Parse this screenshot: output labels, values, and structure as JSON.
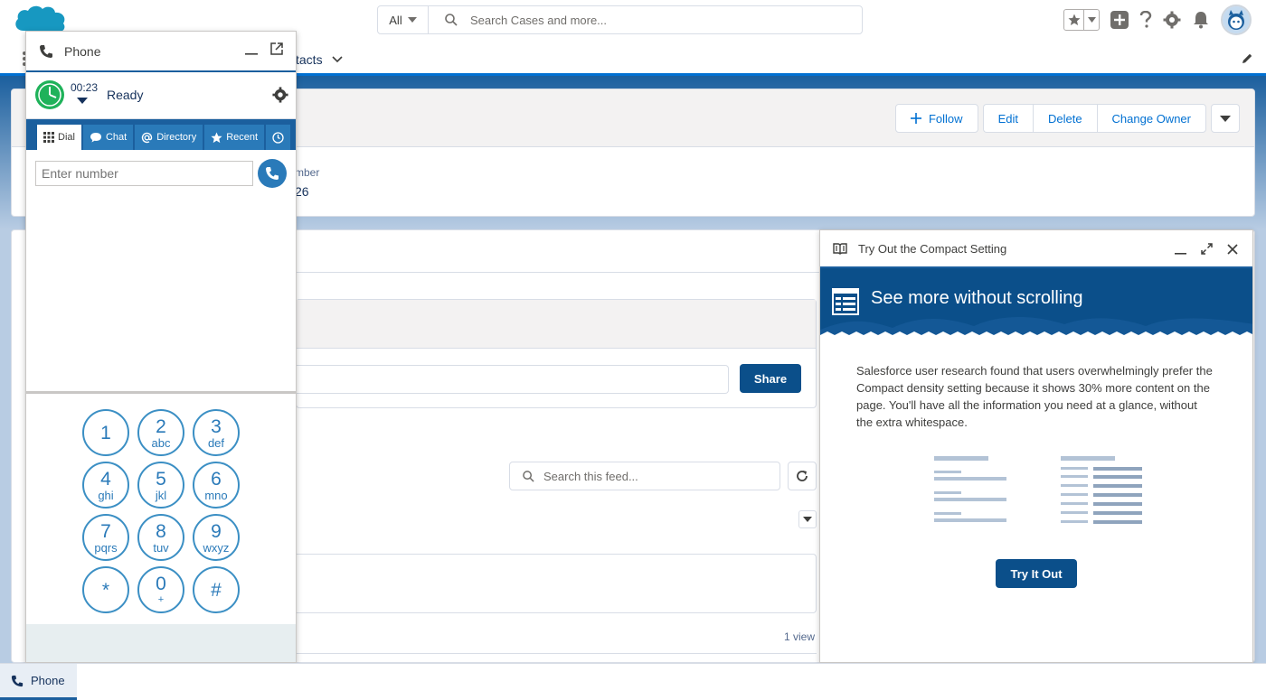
{
  "header": {
    "search_scope": "All",
    "search_placeholder": "Search Cases and more..."
  },
  "nav": {
    "item_label": "tacts"
  },
  "record": {
    "actions": {
      "follow": "Follow",
      "edit": "Edit",
      "delete": "Delete",
      "change_owner": "Change Owner"
    },
    "field_label": "mber",
    "field_value": "26"
  },
  "feed": {
    "share_label": "Share",
    "search_placeholder": "Search this feed...",
    "view_count": "1 view"
  },
  "phone": {
    "title": "Phone",
    "timer": "00:23",
    "status": "Ready",
    "tabs": [
      {
        "label": "Dial",
        "icon": "grid-icon"
      },
      {
        "label": "Chat",
        "icon": "chat-icon"
      },
      {
        "label": "Directory",
        "icon": "at-icon"
      },
      {
        "label": "Recent",
        "icon": "star-icon"
      }
    ],
    "dial_placeholder": "Enter number",
    "keys": [
      {
        "num": "1",
        "letters": ""
      },
      {
        "num": "2",
        "letters": "abc"
      },
      {
        "num": "3",
        "letters": "def"
      },
      {
        "num": "4",
        "letters": "ghi"
      },
      {
        "num": "5",
        "letters": "jkl"
      },
      {
        "num": "6",
        "letters": "mno"
      },
      {
        "num": "7",
        "letters": "pqrs"
      },
      {
        "num": "8",
        "letters": "tuv"
      },
      {
        "num": "9",
        "letters": "wxyz"
      },
      {
        "num": "*",
        "letters": ""
      },
      {
        "num": "0",
        "letters": "+"
      },
      {
        "num": "#",
        "letters": ""
      }
    ]
  },
  "compact": {
    "title": "Try Out the Compact Setting",
    "heading": "See more without scrolling",
    "body": "Salesforce user research found that users overwhelmingly prefer the Compact density setting because it shows 30% more content on the page. You'll have all the information you need at a glance, without the extra whitespace.",
    "button": "Try It Out"
  },
  "utility": {
    "phone_label": "Phone"
  },
  "colors": {
    "brand": "#0070d2",
    "dark_blue": "#0b4f8a",
    "key_blue": "#2a7ab9",
    "ready_green": "#04844b"
  }
}
